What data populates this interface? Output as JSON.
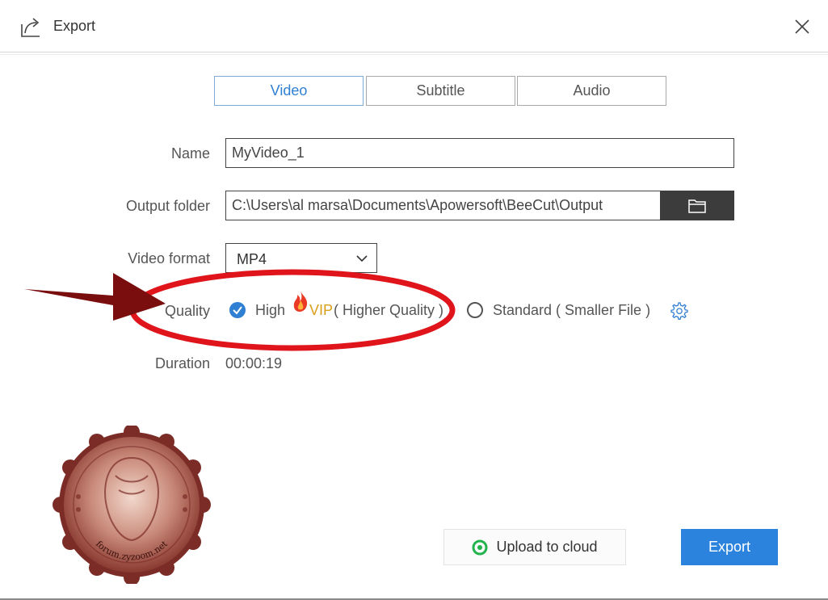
{
  "window": {
    "title": "Export",
    "title_icon": "export-arrow-icon",
    "close_icon": "close-icon"
  },
  "tabs": [
    {
      "label": "Video",
      "active": true
    },
    {
      "label": "Subtitle",
      "active": false
    },
    {
      "label": "Audio",
      "active": false
    }
  ],
  "form": {
    "name": {
      "label": "Name",
      "value": "MyVideo_1"
    },
    "output_folder": {
      "label": "Output folder",
      "value": "C:\\Users\\al marsa\\Documents\\Apowersoft\\BeeCut\\Output",
      "button_icon": "folder-icon"
    },
    "video_format": {
      "label": "Video format",
      "selected": "MP4",
      "icon": "chevron-down-icon"
    },
    "quality": {
      "label": "Quality",
      "high": {
        "label": "High",
        "badge": "VIP",
        "note": "( Higher Quality )",
        "checked": true,
        "badge_icon": "fire-icon"
      },
      "standard": {
        "label": "Standard ( Smaller File )",
        "checked": false
      },
      "settings_icon": "gear-icon"
    },
    "duration": {
      "label": "Duration",
      "value": "00:00:19"
    }
  },
  "buttons": {
    "upload": {
      "label": "Upload to cloud",
      "icon": "cloud-upload-icon"
    },
    "export": {
      "label": "Export"
    }
  },
  "watermark": {
    "text": "forum.zyzoom.net"
  },
  "colors": {
    "accent": "#2b83dd",
    "tab_active_text": "#2f7fd3",
    "vip": "#d8a01a",
    "annotation": "#e0141b",
    "arrow": "#7a0d0d",
    "folder_button": "#3c3c3c"
  }
}
